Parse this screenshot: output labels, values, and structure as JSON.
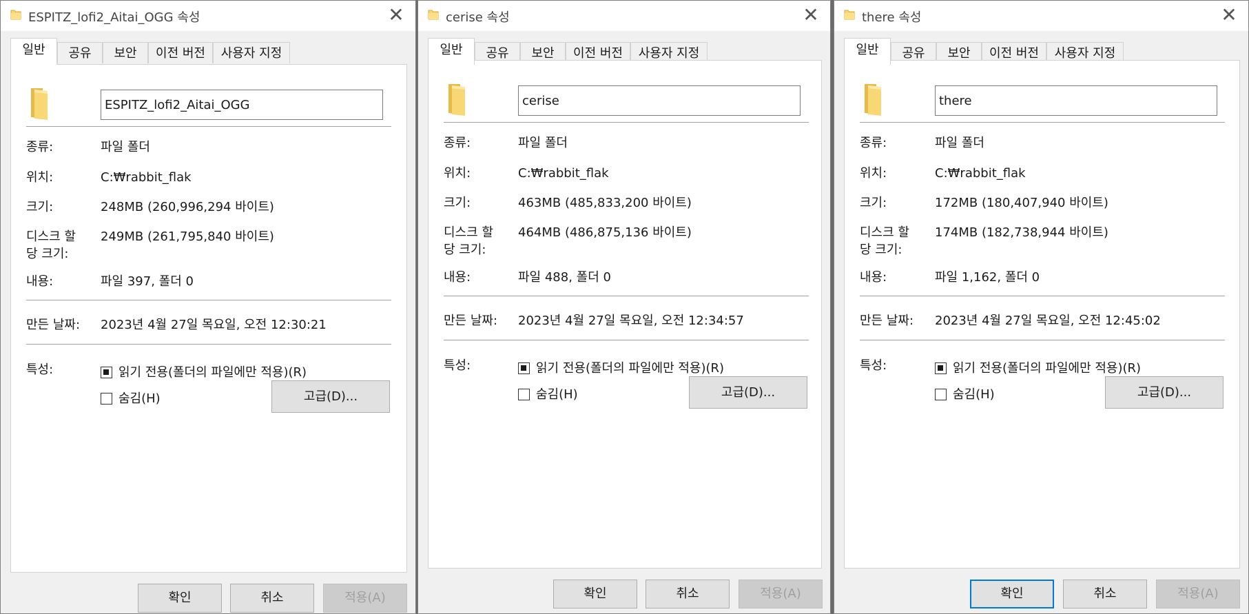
{
  "dialogs": [
    {
      "title": "ESPITZ_lofi2_Aitai_OGG 속성",
      "tabs": [
        "일반",
        "공유",
        "보안",
        "이전 버전",
        "사용자 지정"
      ],
      "name": "ESPITZ_lofi2_Aitai_OGG",
      "type_label": "종류:",
      "type_value": "파일 폴더",
      "location_label": "위치:",
      "location_value": "C:₩rabbit_flak",
      "size_label": "크기:",
      "size_value": "248MB (260,996,294 바이트)",
      "disk_label_1": "디스크 할",
      "disk_label_2": "당 크기:",
      "disk_value": "249MB (261,795,840 바이트)",
      "contents_label": "내용:",
      "contents_value": "파일 397, 폴더 0",
      "created_label": "만든 날짜:",
      "created_value": "2023년 4월 27일 목요일, 오전 12:30:21",
      "attributes_label": "특성:",
      "readonly_label": "읽기 전용(폴더의 파일에만 적용)(R)",
      "hidden_label": "숨김(H)",
      "advanced_label": "고급(D)...",
      "ok_label": "확인",
      "cancel_label": "취소",
      "apply_label": "적용(A)",
      "readonly_state": "indeterminate",
      "hidden_checked": false,
      "ok_focused": false
    },
    {
      "title": "cerise 속성",
      "tabs": [
        "일반",
        "공유",
        "보안",
        "이전 버전",
        "사용자 지정"
      ],
      "name": "cerise",
      "type_label": "종류:",
      "type_value": "파일 폴더",
      "location_label": "위치:",
      "location_value": "C:₩rabbit_flak",
      "size_label": "크기:",
      "size_value": "463MB (485,833,200 바이트)",
      "disk_label_1": "디스크 할",
      "disk_label_2": "당 크기:",
      "disk_value": "464MB (486,875,136 바이트)",
      "contents_label": "내용:",
      "contents_value": "파일 488, 폴더 0",
      "created_label": "만든 날짜:",
      "created_value": "2023년 4월 27일 목요일, 오전 12:34:57",
      "attributes_label": "특성:",
      "readonly_label": "읽기 전용(폴더의 파일에만 적용)(R)",
      "hidden_label": "숨김(H)",
      "advanced_label": "고급(D)...",
      "ok_label": "확인",
      "cancel_label": "취소",
      "apply_label": "적용(A)",
      "readonly_state": "indeterminate",
      "hidden_checked": false,
      "ok_focused": false
    },
    {
      "title": "there 속성",
      "tabs": [
        "일반",
        "공유",
        "보안",
        "이전 버전",
        "사용자 지정"
      ],
      "name": "there",
      "type_label": "종류:",
      "type_value": "파일 폴더",
      "location_label": "위치:",
      "location_value": "C:₩rabbit_flak",
      "size_label": "크기:",
      "size_value": "172MB (180,407,940 바이트)",
      "disk_label_1": "디스크 할",
      "disk_label_2": "당 크기:",
      "disk_value": "174MB (182,738,944 바이트)",
      "contents_label": "내용:",
      "contents_value": "파일 1,162, 폴더 0",
      "created_label": "만든 날짜:",
      "created_value": "2023년 4월 27일 목요일, 오전 12:45:02",
      "attributes_label": "특성:",
      "readonly_label": "읽기 전용(폴더의 파일에만 적용)(R)",
      "hidden_label": "숨김(H)",
      "advanced_label": "고급(D)...",
      "ok_label": "확인",
      "cancel_label": "취소",
      "apply_label": "적용(A)",
      "readonly_state": "indeterminate",
      "hidden_checked": false,
      "ok_focused": true
    }
  ],
  "colors": {
    "folder": "#f8d775",
    "focus": "#0078d7"
  }
}
